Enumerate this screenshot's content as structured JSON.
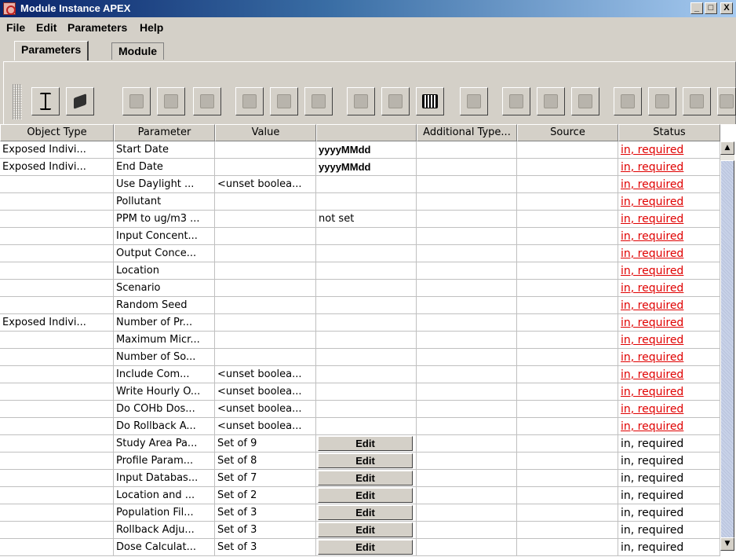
{
  "window": {
    "title": "Module Instance APEX",
    "min": "_",
    "max": "□",
    "close": "X"
  },
  "menu": [
    "File",
    "Edit",
    "Parameters",
    "Help"
  ],
  "tabs": [
    "Parameters",
    "Module"
  ],
  "columns": [
    "Object Type",
    "Parameter",
    "Value",
    "",
    "Additional Type...",
    "Source",
    "Status"
  ],
  "rows": [
    {
      "obj": "Exposed Indivi...",
      "param": "Start Date",
      "value": "",
      "extra": "yyyyMMdd",
      "status": "in, required"
    },
    {
      "obj": "Exposed Indivi...",
      "param": "End Date",
      "value": "",
      "extra": "yyyyMMdd",
      "status": "in, required"
    },
    {
      "obj": "",
      "param": "Use Daylight ...",
      "value": "<unset boolea...",
      "extra": "",
      "status": "in, required"
    },
    {
      "obj": "",
      "param": "Pollutant",
      "value": "",
      "extra": "",
      "status": "in, required"
    },
    {
      "obj": "",
      "param": "PPM to ug/m3 ...",
      "value": "",
      "extra": "not set",
      "status": "in, required"
    },
    {
      "obj": "",
      "param": "Input Concent...",
      "value": "",
      "extra": "",
      "status": "in, required"
    },
    {
      "obj": "",
      "param": "Output Conce...",
      "value": "",
      "extra": "",
      "status": "in, required"
    },
    {
      "obj": "",
      "param": "Location",
      "value": "",
      "extra": "",
      "status": "in, required"
    },
    {
      "obj": "",
      "param": "Scenario",
      "value": "",
      "extra": "",
      "status": "in, required"
    },
    {
      "obj": "",
      "param": "Random Seed",
      "value": "",
      "extra": "",
      "status": "in, required"
    },
    {
      "obj": "Exposed Indivi...",
      "param": "Number of Pr...",
      "value": "",
      "extra": "",
      "status": "in, required"
    },
    {
      "obj": "",
      "param": "Maximum Micr...",
      "value": "",
      "extra": "",
      "status": "in, required"
    },
    {
      "obj": "",
      "param": "Number of So...",
      "value": "",
      "extra": "",
      "status": "in, required"
    },
    {
      "obj": "",
      "param": "Include Com...",
      "value": "<unset boolea...",
      "extra": "",
      "status": "in, required"
    },
    {
      "obj": "",
      "param": "Write Hourly O...",
      "value": "<unset boolea...",
      "extra": "",
      "status": "in, required"
    },
    {
      "obj": "",
      "param": "Do COHb Dos...",
      "value": "<unset boolea...",
      "extra": "",
      "status": "in, required"
    },
    {
      "obj": "",
      "param": "Do Rollback A...",
      "value": "<unset boolea...",
      "extra": "",
      "status": "in, required"
    },
    {
      "obj": "",
      "param": "Study Area Pa...",
      "value": "Set of 9",
      "extra": "Edit",
      "status": "in, required"
    },
    {
      "obj": "",
      "param": "Profile Param...",
      "value": "Set of 8",
      "extra": "Edit",
      "status": "in, required"
    },
    {
      "obj": "",
      "param": "Input Databas...",
      "value": "Set of 7",
      "extra": "Edit",
      "status": "in, required"
    },
    {
      "obj": "",
      "param": "Location and ...",
      "value": "Set of 2",
      "extra": "Edit",
      "status": "in, required"
    },
    {
      "obj": "",
      "param": "Population Fil...",
      "value": "Set of 3",
      "extra": "Edit",
      "status": "in, required"
    },
    {
      "obj": "",
      "param": "Rollback Adju...",
      "value": "Set of 3",
      "extra": "Edit",
      "status": "in, required"
    },
    {
      "obj": "",
      "param": "Dose Calculat...",
      "value": "Set of 3",
      "extra": "Edit",
      "status": "in, required"
    }
  ],
  "toolbar_icons": [
    "resize-icon",
    "cube-icon",
    "undo-icon",
    "redo-icon",
    "cut-icon",
    "copy-icon",
    "paste-icon",
    "delete-icon",
    "pen-icon",
    "add-column-icon",
    "add-module-icon",
    "add-cell-icon",
    "edit-icon",
    "list-icon",
    "chart-icon",
    "export-icon",
    "import-icon",
    "expand-icon",
    "more-icon"
  ],
  "colors": {
    "required": "#e00000",
    "titlebar": "#0a246a",
    "chrome": "#d4d0c8"
  }
}
